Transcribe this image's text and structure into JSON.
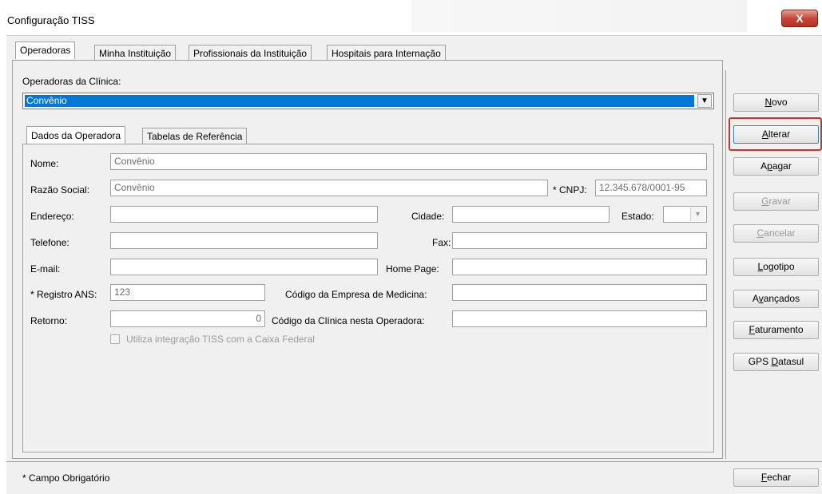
{
  "window": {
    "title": "Configuração TISS",
    "close_glyph": "X"
  },
  "top_tabs": [
    {
      "label": "Operadoras"
    },
    {
      "label": "Minha Instituição"
    },
    {
      "label": "Profissionais da Instituição"
    },
    {
      "label": "Hospitais para Internação"
    }
  ],
  "operadoras": {
    "label": "Operadoras da Clínica:",
    "selected": "Convênio"
  },
  "inner_tabs": [
    {
      "label": "Dados da Operadora"
    },
    {
      "label": "Tabelas de Referência"
    }
  ],
  "form": {
    "nome": {
      "label": "Nome:",
      "value": "Convênio"
    },
    "razao": {
      "label": "Razão Social:",
      "value": "Convênio"
    },
    "cnpj": {
      "label": "* CNPJ:",
      "value": "12.345.678/0001-95"
    },
    "endereco": {
      "label": "Endereço:",
      "value": ""
    },
    "cidade": {
      "label": "Cidade:",
      "value": ""
    },
    "estado": {
      "label": "Estado:",
      "value": ""
    },
    "telefone": {
      "label": "Telefone:",
      "value": ""
    },
    "fax": {
      "label": "Fax:",
      "value": ""
    },
    "email": {
      "label": "E-mail:",
      "value": ""
    },
    "homepage": {
      "label": "Home Page:",
      "value": ""
    },
    "registro": {
      "label": "* Registro ANS:",
      "value": "123"
    },
    "cod_empresa": {
      "label": "Código da Empresa de Medicina:",
      "value": ""
    },
    "retorno": {
      "label": "Retorno:",
      "value": "0"
    },
    "cod_clinica": {
      "label": "Código da Clínica nesta Operadora:",
      "value": ""
    },
    "caixa": {
      "label": "Utiliza integração TISS com a Caixa Federal"
    }
  },
  "buttons": {
    "novo": {
      "pre": "",
      "key": "N",
      "post": "ovo"
    },
    "alterar": {
      "pre": "",
      "key": "A",
      "post": "lterar"
    },
    "apagar": {
      "pre": "A",
      "key": "p",
      "post": "agar"
    },
    "gravar": {
      "pre": "",
      "key": "G",
      "post": "ravar"
    },
    "cancelar": {
      "pre": "",
      "key": "C",
      "post": "ancelar"
    },
    "logotipo": {
      "pre": "",
      "key": "L",
      "post": "ogotipo"
    },
    "avancados": {
      "pre": "A",
      "key": "v",
      "post": "ançados"
    },
    "faturamento": {
      "pre": "",
      "key": "F",
      "post": "aturamento"
    },
    "gps": {
      "pre": "GPS ",
      "key": "D",
      "post": "atasul"
    },
    "fechar": {
      "pre": "",
      "key": "F",
      "post": "echar"
    }
  },
  "footer": {
    "note": "* Campo Obrigatório"
  },
  "colors": {
    "selection": "#0078d7",
    "highlight_border": "#c0392b"
  }
}
